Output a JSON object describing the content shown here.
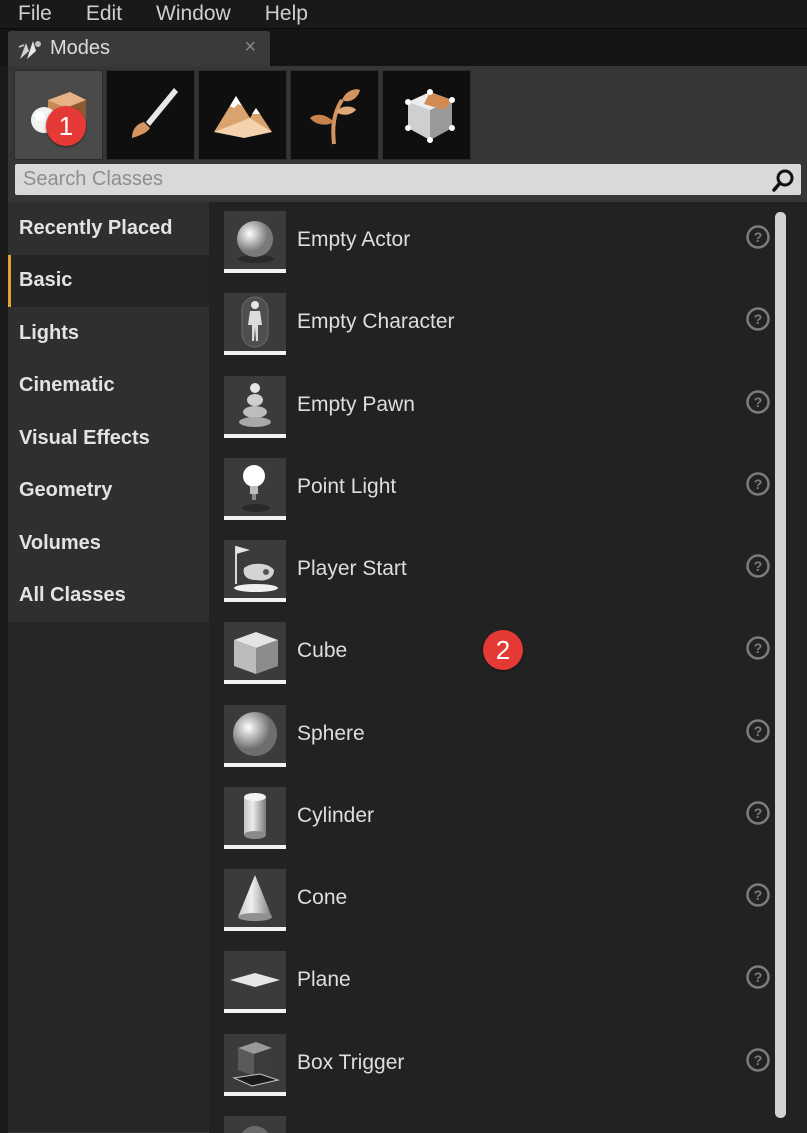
{
  "menubar": {
    "items": [
      "File",
      "Edit",
      "Window",
      "Help"
    ]
  },
  "tab": {
    "title": "Modes",
    "close": "×"
  },
  "mode_toolbar": {
    "buttons": [
      {
        "name": "place-mode-icon",
        "active": true
      },
      {
        "name": "paint-mode-icon",
        "active": false
      },
      {
        "name": "landscape-mode-icon",
        "active": false
      },
      {
        "name": "foliage-mode-icon",
        "active": false
      },
      {
        "name": "geometry-mode-icon",
        "active": false
      }
    ]
  },
  "search": {
    "placeholder": "Search Classes"
  },
  "categories": [
    "Recently Placed",
    "Basic",
    "Lights",
    "Cinematic",
    "Visual Effects",
    "Geometry",
    "Volumes",
    "All Classes"
  ],
  "selected_category": "Basic",
  "items": [
    {
      "label": "Empty Actor",
      "icon": "empty-actor-icon"
    },
    {
      "label": "Empty Character",
      "icon": "empty-character-icon"
    },
    {
      "label": "Empty Pawn",
      "icon": "empty-pawn-icon"
    },
    {
      "label": "Point Light",
      "icon": "point-light-icon"
    },
    {
      "label": "Player Start",
      "icon": "player-start-icon"
    },
    {
      "label": "Cube",
      "icon": "cube-icon"
    },
    {
      "label": "Sphere",
      "icon": "sphere-icon"
    },
    {
      "label": "Cylinder",
      "icon": "cylinder-icon"
    },
    {
      "label": "Cone",
      "icon": "cone-icon"
    },
    {
      "label": "Plane",
      "icon": "plane-icon"
    },
    {
      "label": "Box Trigger",
      "icon": "box-trigger-icon"
    },
    {
      "label": "",
      "icon": "sphere-trigger-icon"
    }
  ],
  "badges": {
    "one": "1",
    "two": "2"
  },
  "colors": {
    "accent": "#e2a33a",
    "badge": "#e53935"
  }
}
